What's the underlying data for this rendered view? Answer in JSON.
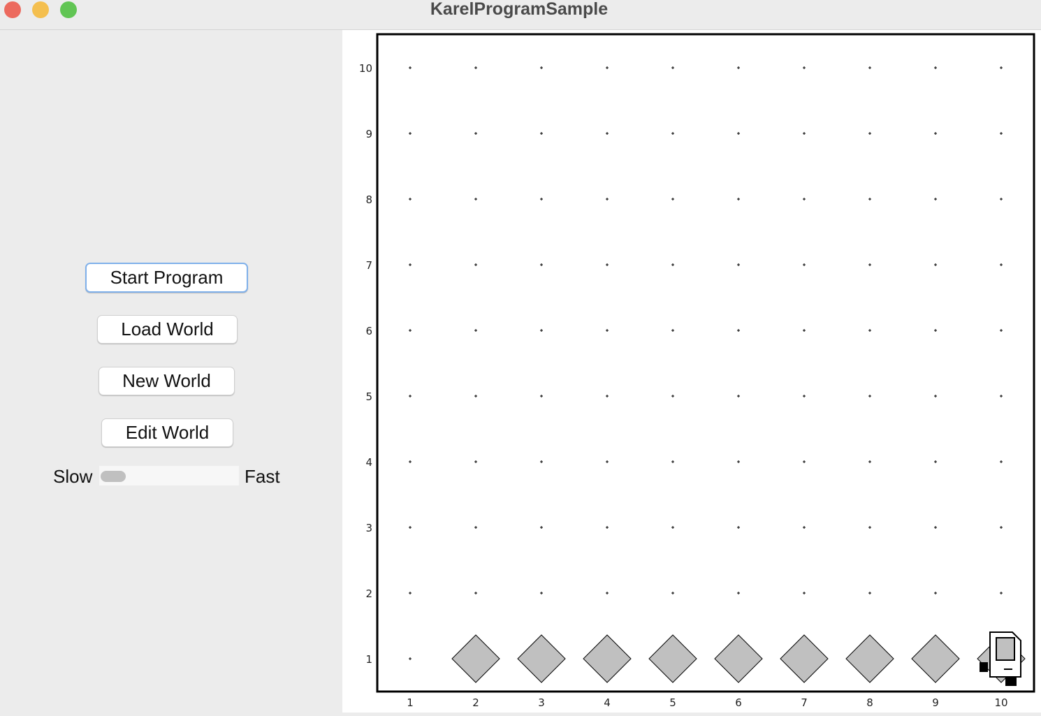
{
  "window": {
    "title": "KarelProgramSample",
    "controls": {
      "close_color": "#ec6a5e",
      "minimize_color": "#f4bf4f",
      "zoom_color": "#61c554"
    }
  },
  "controls": {
    "start_program": "Start Program",
    "load_world": "Load World",
    "new_world": "New World",
    "edit_world": "Edit World",
    "speed": {
      "slow_label": "Slow",
      "fast_label": "Fast",
      "value_fraction": 0
    }
  },
  "world": {
    "columns": 10,
    "rows": 10,
    "column_labels": [
      "1",
      "2",
      "3",
      "4",
      "5",
      "6",
      "7",
      "8",
      "9",
      "10"
    ],
    "row_labels": [
      "1",
      "2",
      "3",
      "4",
      "5",
      "6",
      "7",
      "8",
      "9",
      "10"
    ],
    "beepers": [
      [
        2,
        1
      ],
      [
        3,
        1
      ],
      [
        4,
        1
      ],
      [
        5,
        1
      ],
      [
        6,
        1
      ],
      [
        7,
        1
      ],
      [
        8,
        1
      ],
      [
        9,
        1
      ],
      [
        10,
        1
      ]
    ],
    "beeper_color": "#c0c0c0",
    "karel": {
      "avenue": 10,
      "street": 1,
      "facing": "east"
    }
  }
}
